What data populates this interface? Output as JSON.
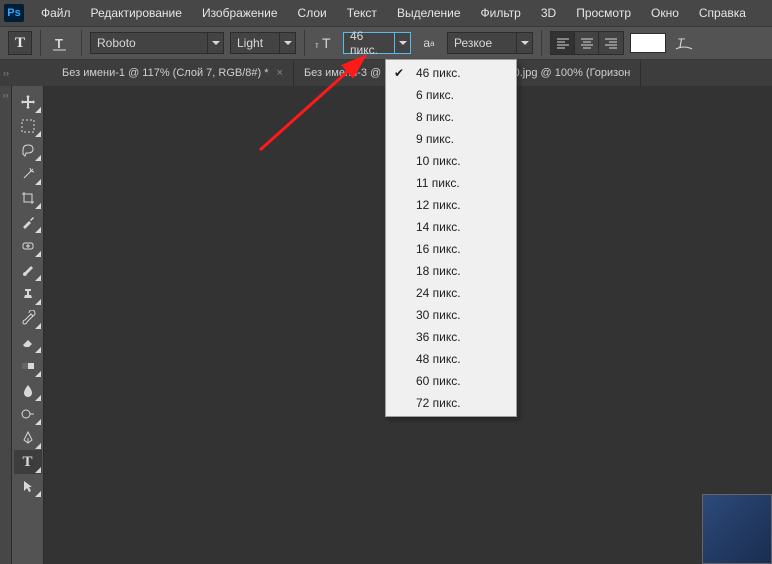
{
  "menu": {
    "items": [
      "Файл",
      "Редактирование",
      "Изображение",
      "Слои",
      "Текст",
      "Выделение",
      "Фильтр",
      "3D",
      "Просмотр",
      "Окно",
      "Справка"
    ]
  },
  "options": {
    "tool_glyph": "T",
    "orientation_glyph": "T",
    "font_family": "Roboto",
    "font_style": "Light",
    "font_size": "46 пикс.",
    "antialias_icon": "aₐ",
    "antialias_mode": "Резкое",
    "size_icon_glyph": "тT"
  },
  "tabs": [
    {
      "title": "Без имени-1 @ 117% (Слой 7, RGB/8#) *",
      "closable": true
    },
    {
      "title": "Без имени-3 @",
      "closable": true
    },
    {
      "title": "hdfon.ru-447579140.jpg @ 100% (Горизон",
      "closable": true
    }
  ],
  "size_dropdown": {
    "selected": "46 пикс.",
    "options": [
      "46 пикс.",
      "6 пикс.",
      "8 пикс.",
      "9 пикс.",
      "10 пикс.",
      "11 пикс.",
      "12 пикс.",
      "14 пикс.",
      "16 пикс.",
      "18 пикс.",
      "24 пикс.",
      "30 пикс.",
      "36 пикс.",
      "48 пикс.",
      "60 пикс.",
      "72 пикс."
    ]
  },
  "tools": [
    "move",
    "marquee",
    "lasso",
    "magic-wand",
    "crop",
    "eyedropper",
    "healing",
    "brush",
    "clone-stamp",
    "history-brush",
    "eraser",
    "gradient",
    "blur",
    "dodge",
    "pen",
    "type",
    "path-select"
  ]
}
